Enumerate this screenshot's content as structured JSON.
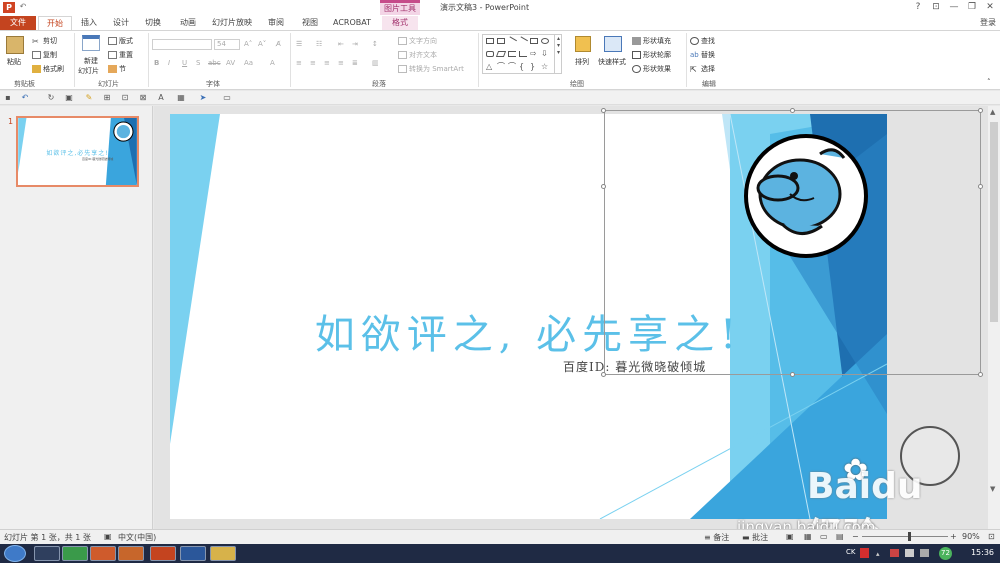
{
  "window": {
    "title": "演示文稿3 - PowerPoint",
    "context_tab_group": "图片工具",
    "controls": [
      "?",
      "⊡",
      "—",
      "❐",
      "✕"
    ],
    "login": "登录"
  },
  "tabs": [
    "文件",
    "开始",
    "插入",
    "设计",
    "切换",
    "动画",
    "幻灯片放映",
    "审阅",
    "视图",
    "ACROBAT",
    "格式"
  ],
  "ribbon": {
    "clipboard": {
      "paste": "粘贴",
      "cut": "剪切",
      "copy": "复制",
      "format_painter": "格式刷",
      "label": "剪贴板"
    },
    "slides": {
      "new_slide": "新建",
      "new_slide2": "幻灯片",
      "layout": "版式",
      "reset": "重置",
      "section": "节",
      "label": "幻灯片"
    },
    "font": {
      "font_size": "54",
      "label": "字体"
    },
    "paragraph": {
      "text_direction": "文字方向",
      "align_text": "对齐文本",
      "smartart": "转换为 SmartArt",
      "label": "段落"
    },
    "drawing": {
      "arrange": "排列",
      "quick_styles": "快速样式",
      "shape_fill": "形状填充",
      "shape_outline": "形状轮廓",
      "shape_effects": "形状效果",
      "label": "绘图"
    },
    "editing": {
      "find": "查找",
      "replace": "替换",
      "select": "选择",
      "label": "编辑"
    }
  },
  "thumbnail": {
    "number": "1",
    "title": "如欲评之,必先享之!",
    "subtitle": "百度ID:暮光微晓破倾城"
  },
  "slide": {
    "title": "如欲评之, 必先享之!",
    "subtitle": "百度ID: 暮光微晓破倾城"
  },
  "statusbar": {
    "slide_info": "幻灯片 第 1 张，共 1 张",
    "language": "中文(中国)",
    "notes": "备注",
    "comments": "批注",
    "zoom": "90%"
  },
  "taskbar": {
    "time": "15:36",
    "badge": "72",
    "ime": "CK"
  },
  "watermark": {
    "brand": "Baidu 经验",
    "url": "jingyan.baidu.com"
  },
  "colors": {
    "accent": "#c4441f",
    "title_text": "#5bc0e8",
    "slide_blue_dark": "#1e6fb0",
    "slide_blue_light": "#7ad1f0"
  }
}
